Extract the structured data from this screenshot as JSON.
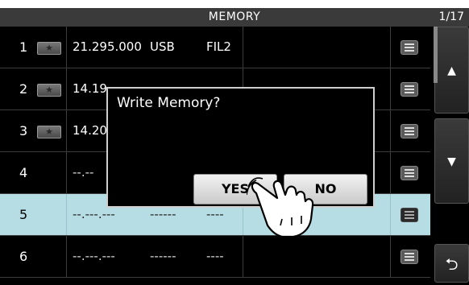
{
  "header": {
    "title": "MEMORY",
    "page": "1/17"
  },
  "rows": [
    {
      "num": "1",
      "has_star": true,
      "freq": "21.295.000",
      "mode": "USB",
      "filter": "FIL2",
      "empty": false
    },
    {
      "num": "2",
      "has_star": true,
      "freq": "14.19",
      "mode": "",
      "filter": "",
      "empty": false
    },
    {
      "num": "3",
      "has_star": true,
      "freq": "14.20",
      "mode": "",
      "filter": "",
      "empty": false
    },
    {
      "num": "4",
      "has_star": false,
      "freq": "--.--",
      "mode": "",
      "filter": "",
      "empty": true
    },
    {
      "num": "5",
      "has_star": false,
      "freq": "--.---.---",
      "mode": "------",
      "filter": "----",
      "empty": true,
      "selected": true
    },
    {
      "num": "6",
      "has_star": false,
      "freq": "--.---.---",
      "mode": "------",
      "filter": "----",
      "empty": true
    }
  ],
  "star_glyph": "★",
  "sidebar": {
    "up_glyph": "▲",
    "down_glyph": "▼",
    "back_glyph": "⮌"
  },
  "dialog": {
    "message": "Write Memory?",
    "yes_label": "YES",
    "no_label": "NO"
  },
  "colors": {
    "selected_row": "#b6dce4",
    "title_bar": "#3a3a3a"
  }
}
